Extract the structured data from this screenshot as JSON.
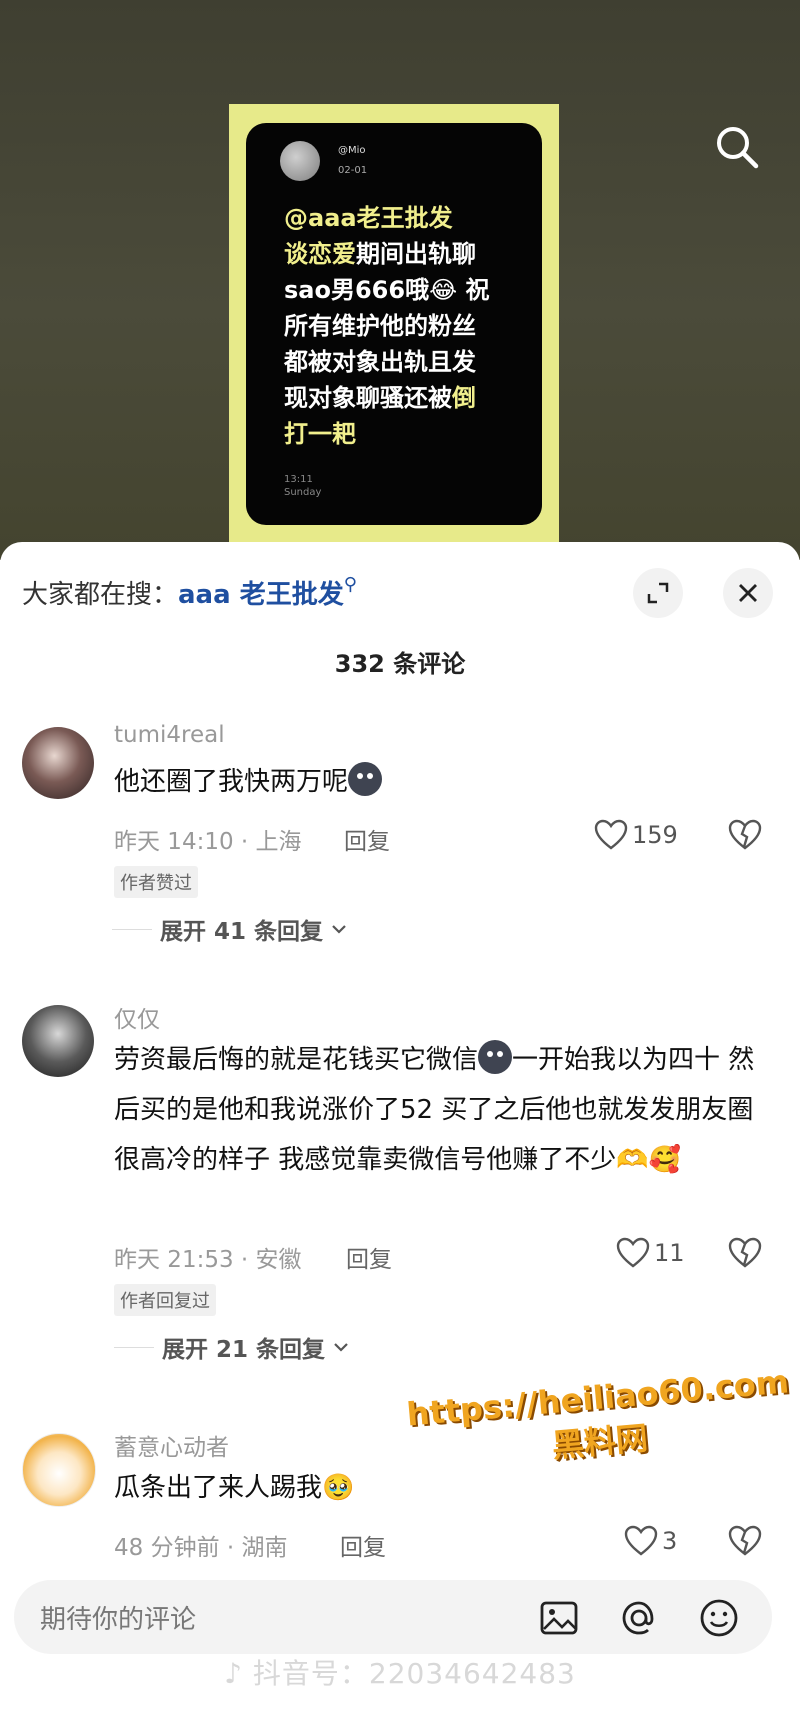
{
  "video": {
    "post_handle": "@Mio",
    "post_date": "02-01",
    "post_lines": [
      {
        "pre": "",
        "hl": "@aaa老王批发",
        "post": ""
      },
      {
        "pre": "",
        "hl": "谈恋爱",
        "post": "期间出轨聊"
      },
      {
        "pre": "sao男666哦😂 祝",
        "hl": "",
        "post": ""
      },
      {
        "pre": "所有维护他的粉丝",
        "hl": "",
        "post": ""
      },
      {
        "pre": "都被对象出轨且发",
        "hl": "",
        "post": ""
      },
      {
        "pre": "现对象聊骚还被",
        "hl": "倒",
        "post": ""
      },
      {
        "pre": "打一耙",
        "hl": "",
        "post": ""
      }
    ],
    "post_time": "13:11",
    "post_day": "Sunday"
  },
  "sheet": {
    "hot_prefix": "大家都在搜：",
    "hot_term": "aaa 老王批发",
    "count_label": "332 条评论"
  },
  "comments": [
    {
      "name": "tumi4real",
      "text": "他还圈了我快两万呢",
      "meta": "昨天 14:10 · 上海",
      "reply": "回复",
      "likes": "159",
      "badge": "作者赞过",
      "expand": "展开 41 条回复"
    },
    {
      "name": "仅仅",
      "text_a": "劳资最后悔的就是花钱买它微信",
      "text_b": "一开始我以为四十 然后买的是他和我说涨价了52 买了之后他也就发发朋友圈很高冷的样子 我感觉靠卖微信号他赚了不少🫶🥰",
      "meta": "昨天 21:53 · 安徽",
      "reply": "回复",
      "likes": "11",
      "badge": "作者回复过",
      "expand": "展开 21 条回复"
    },
    {
      "name": "蓄意心动者",
      "text": "瓜条出了来人踢我🥹",
      "meta": "48 分钟前 · 湖南",
      "reply": "回复",
      "likes": "3"
    }
  ],
  "watermark": {
    "line1": "https://heiliao60.com",
    "line2": "黑料网"
  },
  "input": {
    "placeholder": "期待你的评论"
  },
  "footer": {
    "douyin_id": "抖音号：22034642483"
  },
  "icons": [
    "search-icon",
    "expand-icon",
    "close-icon",
    "heart-icon",
    "broken-heart-icon",
    "chevron-down-icon",
    "image-icon",
    "at-icon",
    "smiley-icon"
  ]
}
